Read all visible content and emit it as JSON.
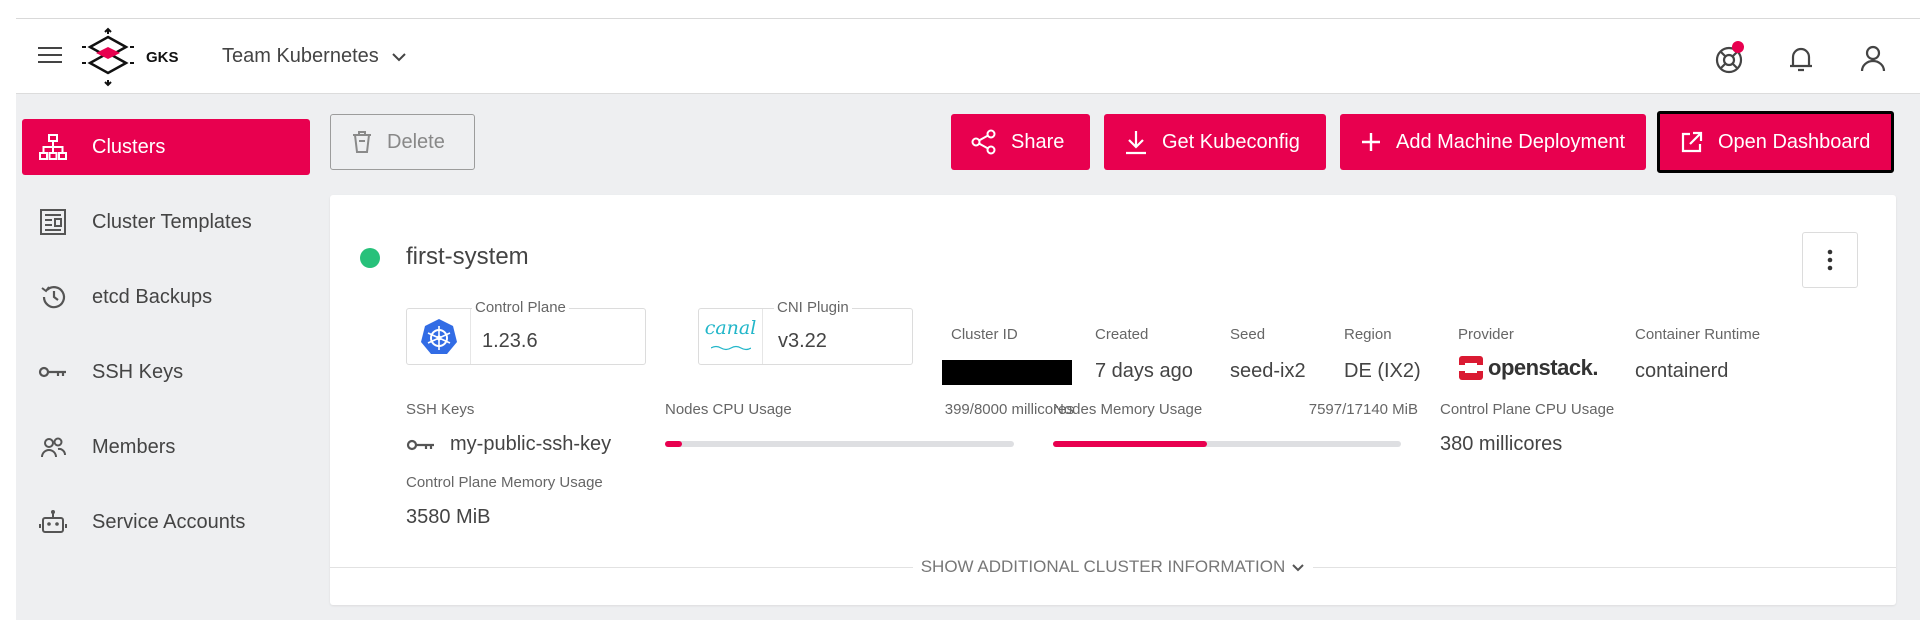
{
  "app": {
    "logo_text": "GKS",
    "team": "Team Kubernetes"
  },
  "sidebar": {
    "items": [
      {
        "label": "Clusters",
        "icon": "sitemap-icon",
        "active": true
      },
      {
        "label": "Cluster Templates",
        "icon": "template-icon"
      },
      {
        "label": "etcd Backups",
        "icon": "history-icon"
      },
      {
        "label": "SSH Keys",
        "icon": "key-icon"
      },
      {
        "label": "Members",
        "icon": "people-icon"
      },
      {
        "label": "Service Accounts",
        "icon": "robot-icon"
      }
    ]
  },
  "toolbar": {
    "delete_label": "Delete",
    "share_label": "Share",
    "kubeconfig_label": "Get Kubeconfig",
    "add_md_label": "Add Machine Deployment",
    "open_dashboard_label": "Open Dashboard"
  },
  "cluster": {
    "name": "first-system",
    "status_color": "#27c17a",
    "control_plane": {
      "label": "Control Plane",
      "value": "1.23.6"
    },
    "cni": {
      "label": "CNI Plugin",
      "value": "v3.22",
      "logo_text": "canal"
    },
    "cluster_id": {
      "label": "Cluster ID"
    },
    "created": {
      "label": "Created",
      "value": "7 days ago"
    },
    "seed": {
      "label": "Seed",
      "value": "seed-ix2"
    },
    "region": {
      "label": "Region",
      "value": "DE (IX2)"
    },
    "provider": {
      "label": "Provider",
      "value": "openstack."
    },
    "runtime": {
      "label": "Container Runtime",
      "value": "containerd"
    },
    "ssh_keys": {
      "label": "SSH Keys",
      "value": "my-public-ssh-key"
    },
    "cpu": {
      "label": "Nodes CPU Usage",
      "value": "399/8000 millicores",
      "fraction": 0.05
    },
    "memory": {
      "label": "Nodes Memory Usage",
      "value": "7597/17140 MiB",
      "fraction": 0.443
    },
    "cp_cpu": {
      "label": "Control Plane CPU Usage",
      "value": "380 millicores"
    },
    "cp_memory": {
      "label": "Control Plane Memory Usage",
      "value": "3580 MiB"
    },
    "more_label": "SHOW ADDITIONAL CLUSTER INFORMATION"
  },
  "colors": {
    "accent": "#e8004f"
  }
}
